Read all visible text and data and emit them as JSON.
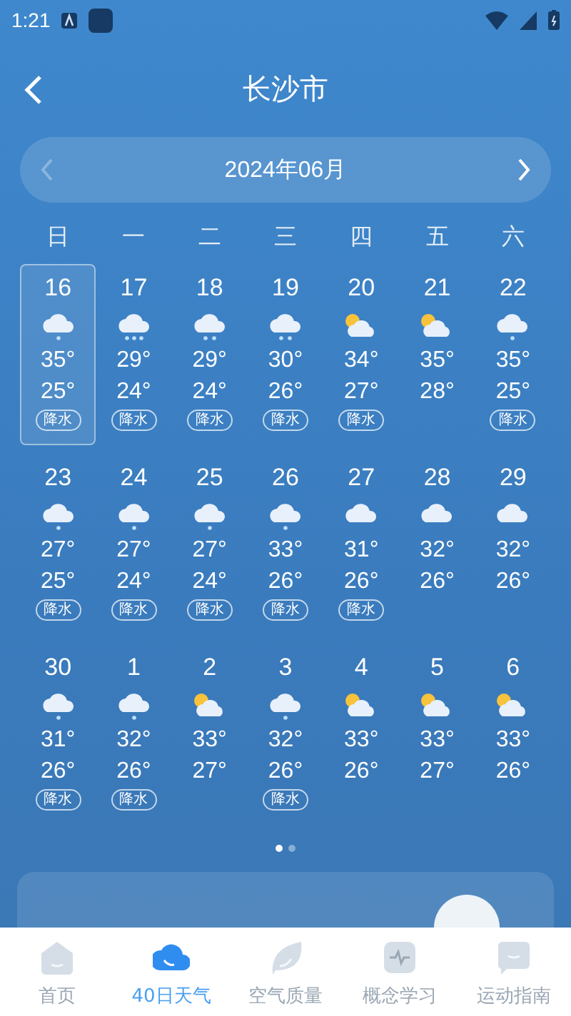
{
  "status_bar": {
    "time": "1:21"
  },
  "header": {
    "title": "长沙市"
  },
  "month_nav": {
    "label": "2024年06月",
    "prev_disabled": true
  },
  "weekdays": [
    "日",
    "一",
    "二",
    "三",
    "四",
    "五",
    "六"
  ],
  "days": [
    {
      "day": "16",
      "kind": "light-rain",
      "high": "35°",
      "low": "25°",
      "badge": "降水",
      "selected": true
    },
    {
      "day": "17",
      "kind": "heavy-rain",
      "high": "29°",
      "low": "24°",
      "badge": "降水",
      "selected": false
    },
    {
      "day": "18",
      "kind": "moderate-rain",
      "high": "29°",
      "low": "24°",
      "badge": "降水",
      "selected": false
    },
    {
      "day": "19",
      "kind": "moderate-rain",
      "high": "30°",
      "low": "26°",
      "badge": "降水",
      "selected": false
    },
    {
      "day": "20",
      "kind": "partly-cloudy",
      "high": "34°",
      "low": "27°",
      "badge": "降水",
      "selected": false
    },
    {
      "day": "21",
      "kind": "partly-cloudy",
      "high": "35°",
      "low": "28°",
      "selected": false
    },
    {
      "day": "22",
      "kind": "light-rain",
      "high": "35°",
      "low": "25°",
      "badge": "降水",
      "selected": false
    },
    {
      "day": "23",
      "kind": "light-rain",
      "high": "27°",
      "low": "25°",
      "badge": "降水",
      "selected": false
    },
    {
      "day": "24",
      "kind": "light-rain",
      "high": "27°",
      "low": "24°",
      "badge": "降水",
      "selected": false
    },
    {
      "day": "25",
      "kind": "light-rain",
      "high": "27°",
      "low": "24°",
      "badge": "降水",
      "selected": false
    },
    {
      "day": "26",
      "kind": "light-rain",
      "high": "33°",
      "low": "26°",
      "badge": "降水",
      "selected": false
    },
    {
      "day": "27",
      "kind": "cloudy",
      "high": "31°",
      "low": "26°",
      "badge": "降水",
      "selected": false
    },
    {
      "day": "28",
      "kind": "cloudy",
      "high": "32°",
      "low": "26°",
      "selected": false
    },
    {
      "day": "29",
      "kind": "cloudy",
      "high": "32°",
      "low": "26°",
      "selected": false
    },
    {
      "day": "30",
      "kind": "light-rain",
      "high": "31°",
      "low": "26°",
      "badge": "降水",
      "selected": false
    },
    {
      "day": "1",
      "kind": "light-rain",
      "high": "32°",
      "low": "26°",
      "badge": "降水",
      "selected": false
    },
    {
      "day": "2",
      "kind": "partly-cloudy",
      "high": "33°",
      "low": "27°",
      "selected": false
    },
    {
      "day": "3",
      "kind": "light-rain",
      "high": "32°",
      "low": "26°",
      "badge": "降水",
      "selected": false
    },
    {
      "day": "4",
      "kind": "partly-cloudy",
      "high": "33°",
      "low": "26°",
      "selected": false
    },
    {
      "day": "5",
      "kind": "partly-cloudy",
      "high": "33°",
      "low": "27°",
      "selected": false
    },
    {
      "day": "6",
      "kind": "partly-cloudy",
      "high": "33°",
      "low": "26°",
      "selected": false
    }
  ],
  "pager": [
    {
      "selected": true
    },
    {
      "selected": false
    }
  ],
  "tabs": [
    {
      "label": "首页",
      "kind": "home",
      "selected": false
    },
    {
      "label": "40日天气",
      "kind": "cloud",
      "selected": true
    },
    {
      "label": "空气质量",
      "kind": "leaf",
      "selected": false
    },
    {
      "label": "概念学习",
      "kind": "pulse",
      "selected": false
    },
    {
      "label": "运动指南",
      "kind": "chat",
      "selected": false
    }
  ]
}
